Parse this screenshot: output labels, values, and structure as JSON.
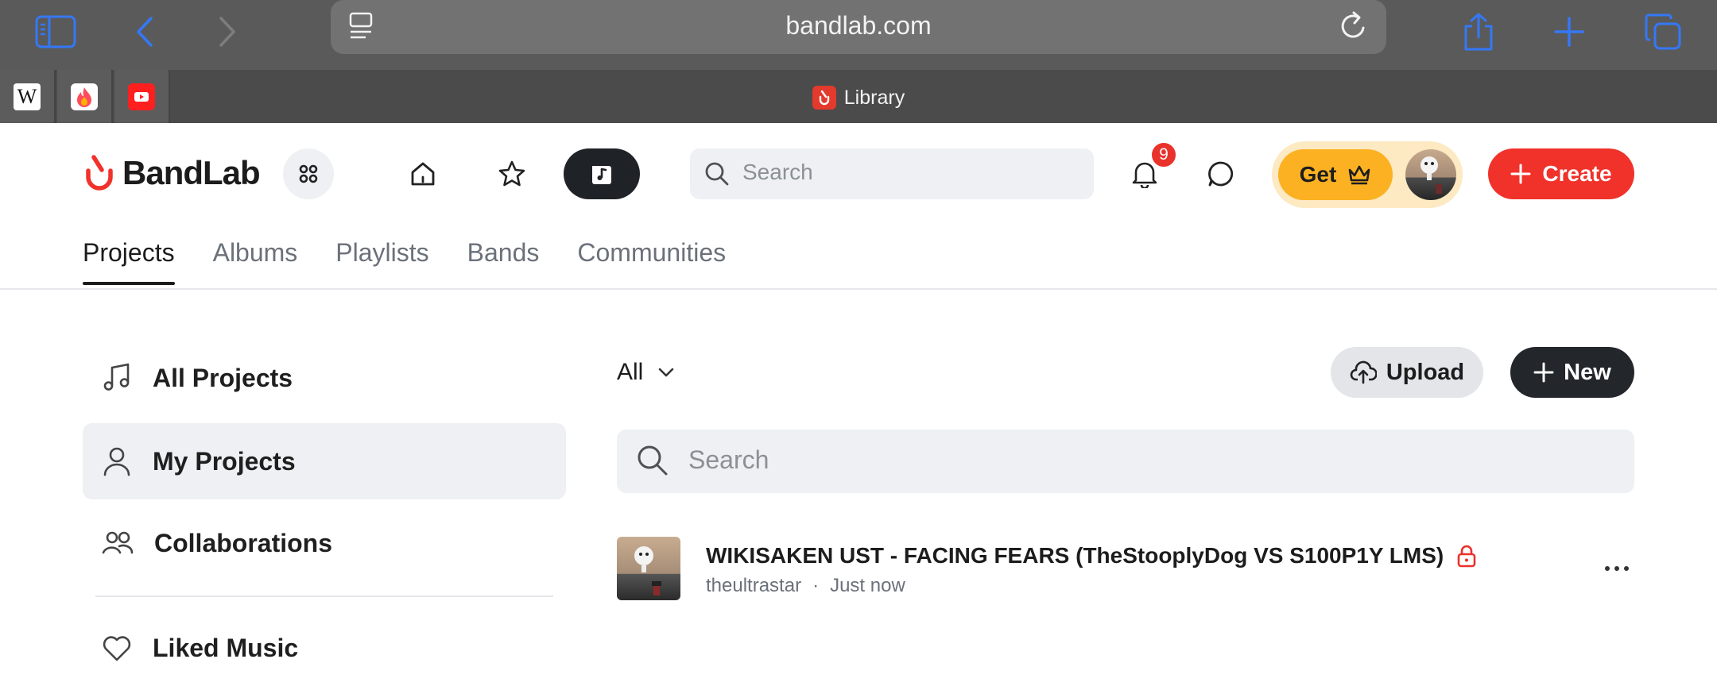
{
  "browser": {
    "url": "bandlab.com",
    "active_tab_title": "Library",
    "pinned_tabs": [
      {
        "name": "Wikipedia",
        "glyph": "W"
      },
      {
        "name": "Tinder",
        "glyph": ""
      },
      {
        "name": "YouTube",
        "glyph": ""
      }
    ]
  },
  "header": {
    "logo_text": "BandLab",
    "search_placeholder": "Search",
    "notification_count": "9",
    "get_label": "Get",
    "create_label": "Create"
  },
  "library_tabs": [
    "Projects",
    "Albums",
    "Playlists",
    "Bands",
    "Communities"
  ],
  "sidebar": {
    "items": [
      {
        "label": "All Projects",
        "icon": "music-note-icon"
      },
      {
        "label": "My Projects",
        "icon": "person-icon"
      },
      {
        "label": "Collaborations",
        "icon": "people-icon"
      },
      {
        "label": "Liked Music",
        "icon": "heart-icon"
      }
    ]
  },
  "main": {
    "filter_label": "All",
    "upload_label": "Upload",
    "new_label": "New",
    "search_placeholder": "Search",
    "projects": [
      {
        "title": "WIKISAKEN UST - FACING FEARS (TheStooplyDog VS S100P1Y LMS)",
        "author": "theultrastar",
        "separator": "·",
        "time": "Just now",
        "private": true
      }
    ]
  },
  "colors": {
    "brand_red": "#f0322b",
    "premium_yellow": "#fbb122",
    "safari_blue": "#3478f6"
  }
}
